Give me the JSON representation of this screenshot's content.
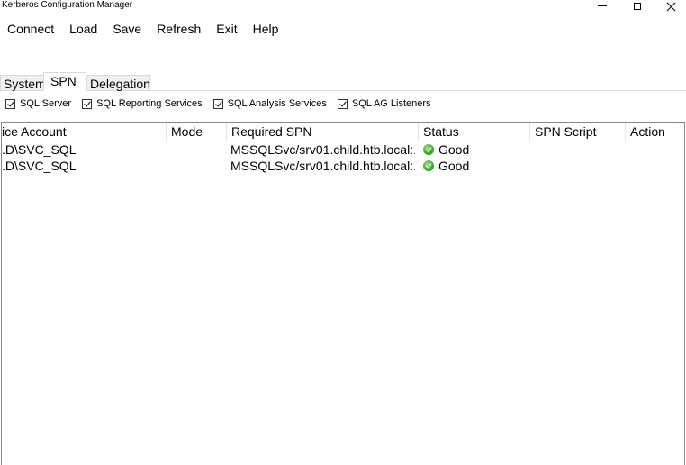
{
  "window": {
    "title": "Kerberos Configuration Manager"
  },
  "menu": [
    "Connect",
    "Load",
    "Save",
    "Refresh",
    "Exit",
    "Help"
  ],
  "tabs": [
    "System",
    "SPN",
    "Delegation"
  ],
  "filters": [
    "SQL Server",
    "SQL Reporting Services",
    "SQL Analysis Services",
    "SQL AG Listeners"
  ],
  "grid": {
    "columns": [
      "ice Account",
      "Mode",
      "Required SPN",
      "Status",
      "SPN Script",
      "Action"
    ],
    "rows": [
      {
        "account": ".D\\SVC_SQL",
        "mode": "",
        "spn": "MSSQLSvc/srv01.child.htb.local:...",
        "status": "Good"
      },
      {
        "account": ".D\\SVC_SQL",
        "mode": "",
        "spn": "MSSQLSvc/srv01.child.htb.local:...",
        "status": "Good"
      }
    ]
  }
}
